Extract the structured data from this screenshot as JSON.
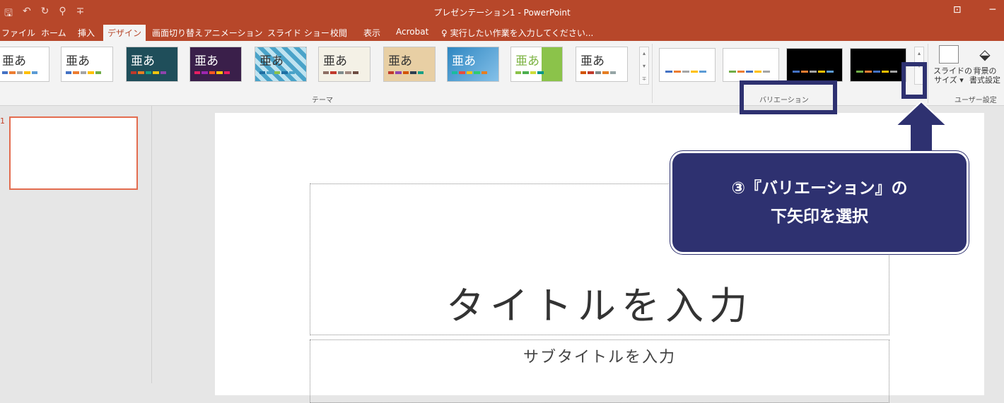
{
  "titlebar": {
    "title": "プレゼンテーション1 - PowerPoint",
    "qat_save": "🖫",
    "qat_undo": "↶",
    "qat_redo": "↻",
    "qat_present": "⚲",
    "qat_more": "∓",
    "win_restore": "⊡",
    "win_min": "─"
  },
  "tabs": [
    {
      "label": "ファイル"
    },
    {
      "label": "ホーム"
    },
    {
      "label": "挿入"
    },
    {
      "label": "デザイン"
    },
    {
      "label": "画面切り替え"
    },
    {
      "label": "アニメーション"
    },
    {
      "label": "スライド ショー"
    },
    {
      "label": "校閲"
    },
    {
      "label": "表示"
    },
    {
      "label": "Acrobat"
    },
    {
      "label": "♀ 実行したい作業を入力してください..."
    }
  ],
  "themes": {
    "sample_text": "亜あ",
    "group_label": "テーマ"
  },
  "variations": {
    "group_label": "バリエーション",
    "more_button": "▿"
  },
  "customize": {
    "group_label": "ユーザー設定",
    "slide_size": "スライドの\nサイズ ▾",
    "format_background": "背景の\n書式設定"
  },
  "slides": {
    "number": "1"
  },
  "slide": {
    "title_placeholder": "タイトルを入力",
    "subtitle_placeholder": "サブタイトルを入力"
  },
  "callout": {
    "line1": "③『バリエーション』の",
    "line2": "下矢印を選択"
  },
  "colors": {
    "accent": "#b7472a",
    "annotation": "#2e3170"
  }
}
